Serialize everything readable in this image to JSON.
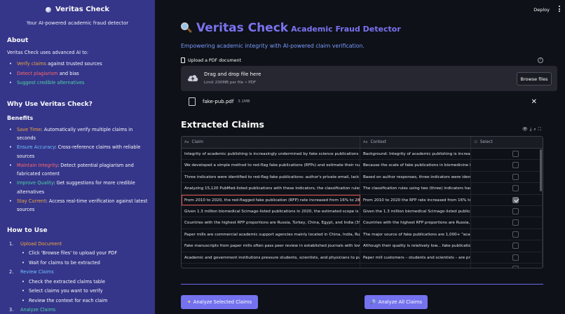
{
  "sidebar": {
    "title": "Veritas Check",
    "subtitle": "Your AI-powered academic fraud detector",
    "about_heading": "About",
    "about_text": "Veritas Check uses advanced AI to:",
    "about_items": [
      {
        "highlight": "Verify claims",
        "rest": " against trusted sources",
        "color": "#f0a640"
      },
      {
        "highlight": "Detect plagiarism",
        "rest": " and bias",
        "color": "#ff6a6a"
      },
      {
        "highlight": "Suggest credible alternatives",
        "rest": "",
        "color": "#4fd6a2"
      }
    ],
    "why_heading": "Why Use Veritas Check?",
    "benefits_heading": "Benefits",
    "benefits": [
      {
        "highlight": "Save Time",
        "rest": ": Automatically verify multiple claims in seconds"
      },
      {
        "highlight": "Ensure Accuracy",
        "rest": ": Cross-reference claims with reliable sources"
      },
      {
        "highlight": "Maintain Integrity",
        "rest": ": Detect potential plagiarism and fabricated content"
      },
      {
        "highlight": "Improve Quality",
        "rest": ": Get suggestions for more credible alternatives"
      },
      {
        "highlight": "Stay Current",
        "rest": ": Access real-time verification against latest sources"
      }
    ],
    "howto_heading": "How to Use",
    "steps": [
      {
        "num": "1.",
        "label": "Upload Document",
        "subs": [
          "Click 'Browse files' to upload your PDF",
          "Wait for claims to be extracted"
        ]
      },
      {
        "num": "2.",
        "label": "Review Claims",
        "subs": [
          "Check the extracted claims table",
          "Select claims you want to verify",
          "Review the context for each claim"
        ]
      },
      {
        "num": "3.",
        "label": "Analyze Claims",
        "subs": []
      }
    ]
  },
  "header": {
    "deploy_label": "Deploy"
  },
  "main": {
    "title": "Veritas Check",
    "title_suffix": "Academic Fraud Detector",
    "tagline": "Empowering academic integrity with AI-powered claim verification.",
    "upload_label": "Upload a PDF document",
    "dropzone_main": "Drag and drop file here",
    "dropzone_sub": "Limit 200MB per file • PDF",
    "browse_label": "Browse files",
    "file_name": "fake-pub.pdf",
    "file_size": "3.1MB",
    "section_heading": "Extracted Claims",
    "columns": [
      "Claim",
      "Context",
      "Select"
    ],
    "rows": [
      {
        "claim": "Integrity of academic publishing is increasingly undermined by fake science publications massively produced by",
        "context": "Background: Integrity of academic publishing is increasingly undermined",
        "checked": false
      },
      {
        "claim": "We developed a simple method to red-flag fake publications (RFPs) and estimate their numbers in biomedicine",
        "context": "Because the scale of fake publications in biomedicine is unknown",
        "checked": false
      },
      {
        "claim": "Three indicators were identified to red-flag fake publications: author's private email, lack of international co-",
        "context": "Based on author responses, three indicators were identified",
        "checked": false
      },
      {
        "claim": "Analyzing 15,120 PubMed-listed publications with these indicators, the classification rules had a",
        "context": "The classification rules using two (three) indicators had sensitivity",
        "checked": false
      },
      {
        "claim": "From 2010 to 2020, the red-flagged fake publication (RFP) rate increased from 16% to 28%.",
        "context": "From 2010 to 2020 the RFP rate increased from 16% to 28%",
        "checked": true
      },
      {
        "claim": "Given 1.3 million biomedical Scimago-listed publications in 2020, the estimated scope is over",
        "context": "Given the 1.3 million biomedical Scimago-listed publications",
        "checked": false
      },
      {
        "claim": "Countries with the highest RFP proportions are Russia, Turkey, China, Egypt, and India (39%-48%)",
        "context": "Countries with the highest RFP proportions are Russia, Turkey",
        "checked": false
      },
      {
        "claim": "Paper mills are commercial academic support agencies mainly located in China, India, Russia",
        "context": "The major source of fake publications are 1,000+ \"academic",
        "checked": false
      },
      {
        "claim": "Fake manuscripts from paper mills often pass peer review in established journals with low to moderate",
        "context": "Although their quality is relatively low... fake publications",
        "checked": false
      },
      {
        "claim": "Academic and government institutions pressure students, scientists, and physicians to publish",
        "context": "Paper mill customers – students and scientists – are pressured",
        "checked": false
      },
      {
        "claim": "",
        "context": "",
        "checked": false
      }
    ],
    "analyze_selected_label": "Analyze Selected Claims",
    "analyze_all_label": "Analyze All Claims"
  }
}
